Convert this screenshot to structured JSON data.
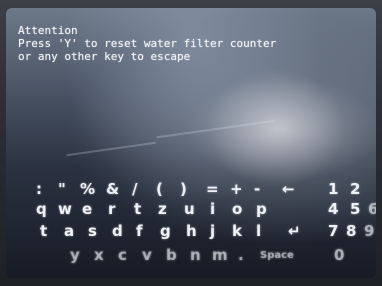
{
  "message": {
    "title": "Attention",
    "line1": "Press 'Y' to reset water filter counter",
    "line2": "or any other key to escape"
  },
  "keyboard": {
    "row1": [
      ":",
      "\"",
      "%",
      "&",
      "/",
      "(",
      ")",
      "=",
      "+",
      "-",
      "←",
      "1",
      "2"
    ],
    "row2": [
      "q",
      "w",
      "e",
      "r",
      "t",
      "z",
      "u",
      "i",
      "o",
      "p",
      "4",
      "5",
      "6"
    ],
    "row3": [
      "t",
      "a",
      "s",
      "d",
      "f",
      "g",
      "h",
      "j",
      "k",
      "l",
      "↵",
      "7",
      "8",
      "9"
    ],
    "row4": [
      "y",
      "x",
      "c",
      "v",
      "b",
      "n",
      "m",
      ".",
      "Space",
      "0"
    ]
  }
}
